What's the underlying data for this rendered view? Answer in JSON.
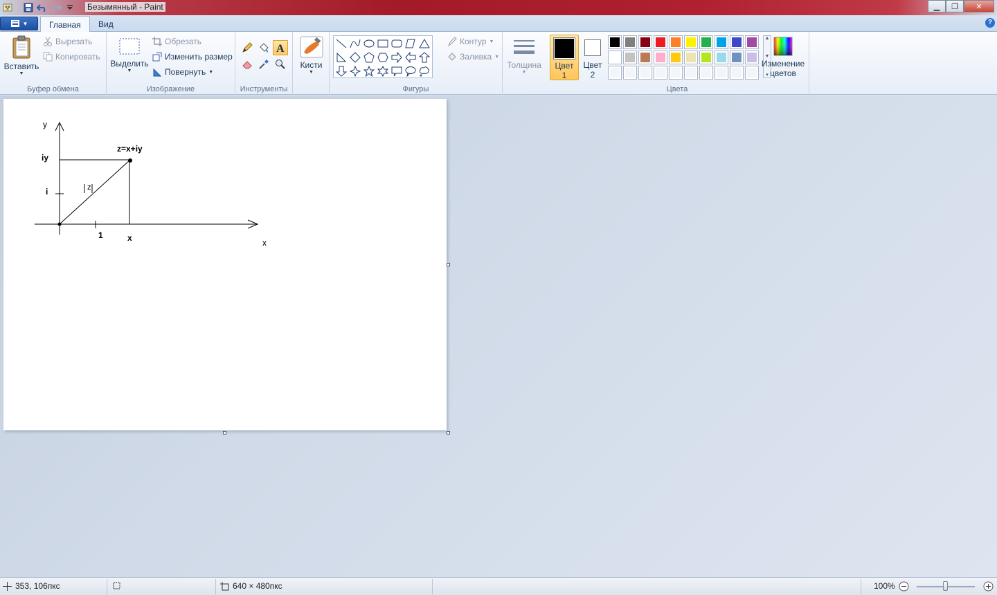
{
  "window": {
    "title": "Безымянный - Paint"
  },
  "tabs": {
    "home": "Главная",
    "view": "Вид"
  },
  "clipboard": {
    "paste": "Вставить",
    "cut": "Вырезать",
    "copy": "Копировать",
    "label": "Буфер обмена"
  },
  "image": {
    "select": "Выделить",
    "crop": "Обрезать",
    "resize": "Изменить размер",
    "rotate": "Повернуть",
    "label": "Изображение"
  },
  "tools": {
    "label": "Инструменты",
    "active": "text-tool"
  },
  "brushes": {
    "label": "Кисти"
  },
  "shapes": {
    "label": "Фигуры",
    "outline": "Контур",
    "fill": "Заливка"
  },
  "size": {
    "label": "Толщина"
  },
  "colors": {
    "color1_label": "Цвет",
    "color1_num": "1",
    "color2_label": "Цвет",
    "color2_num": "2",
    "edit_line1": "Изменение",
    "edit_line2": "цветов",
    "label": "Цвета",
    "color1": "#000000",
    "color2": "#ffffff",
    "palette_row1": [
      "#000000",
      "#7f7f7f",
      "#880015",
      "#ed1c24",
      "#ff7f27",
      "#fff200",
      "#22b14c",
      "#00a2e8",
      "#3f48cc",
      "#a349a4"
    ],
    "palette_row2": [
      "#ffffff",
      "#c3c3c3",
      "#b97a57",
      "#ffaec9",
      "#ffc90e",
      "#efe4b0",
      "#b5e61d",
      "#99d9ea",
      "#7092be",
      "#c8bfe7"
    ]
  },
  "drawing": {
    "y_label": "y",
    "x_label": "x",
    "iy_label": "iy",
    "i_label": "i",
    "one_label": "1",
    "x_tick_label": "x",
    "point_label": "z=x+iy",
    "modulus_label": "|z|"
  },
  "status": {
    "cursor": "353, 106пкс",
    "size": "640 × 480пкс",
    "zoom": "100%"
  }
}
